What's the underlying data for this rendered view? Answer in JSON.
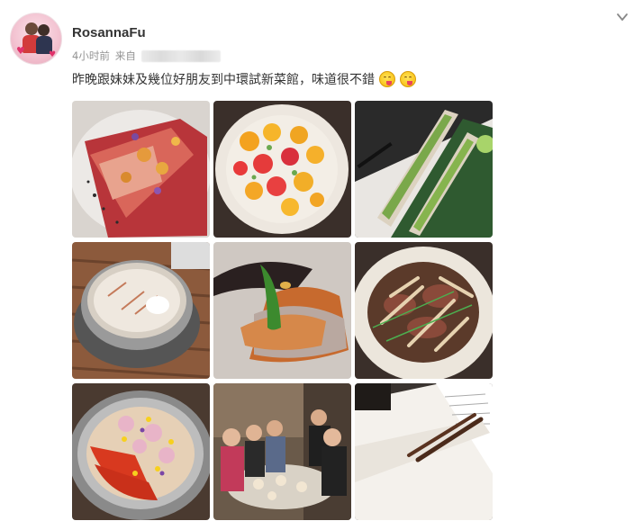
{
  "post": {
    "username": "RosannaFu",
    "time": "4小时前",
    "source_label": "来自",
    "text": "昨晚跟妹妹及幾位好朋友到中環試新菜館，味道很不錯",
    "emojis": [
      "yum-emoji",
      "yum-emoji"
    ]
  },
  "photos": [
    {
      "name": "photo-sashimi-plate"
    },
    {
      "name": "photo-tomato-bowl"
    },
    {
      "name": "photo-crab-legs"
    },
    {
      "name": "photo-rice-pot"
    },
    {
      "name": "photo-grilled-fish"
    },
    {
      "name": "photo-beef-mushrooms"
    },
    {
      "name": "photo-roe-rice-pot"
    },
    {
      "name": "photo-group-dinner"
    },
    {
      "name": "photo-menu-chopsticks"
    }
  ],
  "colors": {
    "username": "#333333",
    "meta": "#939393",
    "text": "#333333"
  }
}
